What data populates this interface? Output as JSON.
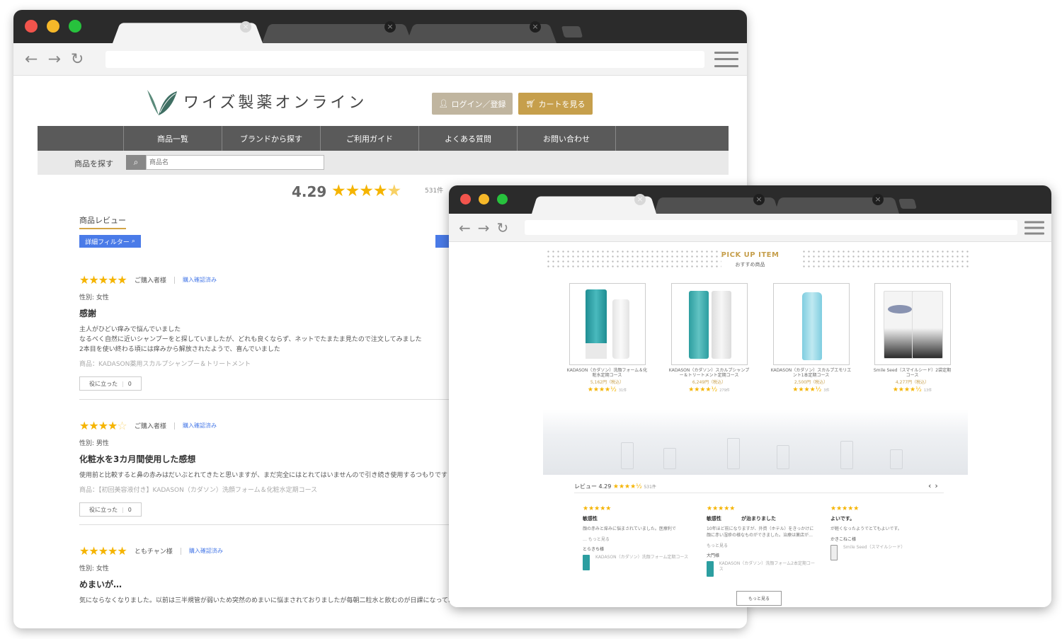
{
  "browser_back": {
    "nav": {
      "back": "←",
      "forward": "→",
      "reload": "↻"
    },
    "site": {
      "name": "ワイズ製薬オンライン",
      "login_button": "ログイン／登録",
      "cart_button": "カートを見る"
    },
    "menu": [
      "商品一覧",
      "ブランドから探す",
      "ご利用ガイド",
      "よくある質問",
      "お問い合わせ"
    ],
    "search": {
      "label": "商品を探す",
      "placeholder": "商品名"
    },
    "rating": {
      "score": "4.29",
      "count": "531件"
    },
    "reviews_tab": "商品レビュー",
    "filter_button": "詳細フィルター",
    "reviews": [
      {
        "rating": 5,
        "name": "ご購入者様",
        "verified": "購入確認済み",
        "gender": "性別: 女性",
        "title": "感謝",
        "body": [
          "主人がひどい痒みで悩んでいました",
          "なるべく自然に近いシャンプーをと探していましたが、どれも良くならず、ネットでたまたま見たので注文してみました",
          "2本目を使い終わる頃には痒みから解放されたようで、喜んでいました"
        ],
        "product": "商品：KADASON薬用スカルプシャンプー＆トリートメント",
        "helpful": "役に立った",
        "helpful_count": "0"
      },
      {
        "rating": 4,
        "name": "ご購入者様",
        "verified": "購入確認済み",
        "gender": "性別: 男性",
        "title": "化粧水を3カ月間使用した感想",
        "body": [
          "使用前と比較すると鼻の赤みはだいぶとれてきたと思いますが、まだ完全にはとれてはいませんので引き続き使用するつもりです"
        ],
        "product": "商品：【初回美容液付き】KADASON（カダソン）洗顔フォーム＆化粧水定期コース",
        "helpful": "役に立った",
        "helpful_count": "0"
      },
      {
        "rating": 5,
        "name": "ともチャン様",
        "verified": "購入確認済み",
        "gender": "性別: 女性",
        "title": "めまいが…",
        "body": [
          "気にならなくなりました。以前は三半規管が弱いため突然のめまいに悩まされておりましたが毎朝二粒水と飲むのが日課になっております"
        ]
      }
    ]
  },
  "browser_front": {
    "nav": {
      "back": "←",
      "forward": "→",
      "reload": "↻"
    },
    "pickup": {
      "title": "PICK UP ITEM",
      "subtitle": "おすすめ商品"
    },
    "products": [
      {
        "name": "KADASON（カダソン）洗顔フォーム＆化粧水定期コース",
        "price": "5,162円（税込）",
        "stars": "★★★★½",
        "count": "31件"
      },
      {
        "name": "KADASON（カダソン）スカルプシャンプー＆トリートメント定期コース",
        "price": "6,249円（税込）",
        "stars": "★★★★½",
        "count": "279件"
      },
      {
        "name": "KADASON（カダソン）スカルプエモリエント1本定期コース",
        "price": "2,500円（税込）",
        "stars": "★★★★½",
        "count": "3件"
      },
      {
        "name": "Smile Seed（スマイルシード）2袋定期コース",
        "price": "4,277円（税込）",
        "stars": "★★★★½",
        "count": "13件"
      }
    ],
    "review_summary": {
      "label": "レビュー",
      "score": "4.29",
      "stars": "★★★★½",
      "count": "531件",
      "prev": "‹",
      "next": "›"
    },
    "review_cards": [
      {
        "stars": "★★★★★",
        "title": "敏感性",
        "body": "顔の赤みと痒みに悩まされていました。医療利で",
        "more": "… もっと見る",
        "name": "とらきち様",
        "product": "KADASON（カダソン）洗顔フォーム定期コース"
      },
      {
        "stars": "★★★★★",
        "title": "敏感性　　　　が治まりました",
        "body": "10年ほど前になりますが、外資（ホテル）をきっかけに顔に赤い湿疹の様なものができました。治療は薬店が…",
        "more": "もっと見る",
        "name": "大門様",
        "product": "KADASON（カダソン）洗顔フォーム2本定期コース"
      },
      {
        "stars": "★★★★★",
        "title": "よいです。",
        "body": "が軽くなったようでとてもよいです。",
        "more": "",
        "name": "かきこねこ様",
        "product": "Smile Seed（スマイルシード）"
      }
    ],
    "more_button": "もっと見る"
  },
  "colors": {
    "gold": "#c69f4c",
    "star": "#f5b400",
    "nav_gray": "#5a5a5a",
    "link_blue": "#4a7be8"
  }
}
